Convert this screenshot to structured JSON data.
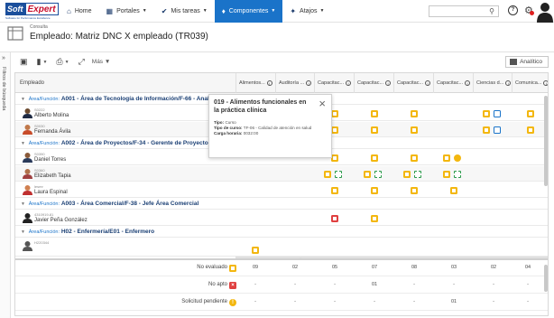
{
  "app": {
    "logo_top": "Soft",
    "logo_bottom": "Expert",
    "logo_sub": "Software for Performance Excellence"
  },
  "nav": {
    "home": "Home",
    "portales": "Portales",
    "mis_tareas": "Mis tareas",
    "componentes": "Componentes",
    "atajos": "Atajos"
  },
  "header": {
    "breadcrumb": "Consulta",
    "title": "Empleado: Matriz DNC X empleado (TR039)"
  },
  "leftbar": {
    "label": "Filtros de búsqueda"
  },
  "toolbar": {
    "more": "Más",
    "analitico": "Analítico"
  },
  "grid": {
    "first_col": "Empleado",
    "columns": [
      "Alimentos...",
      "Auditoría ...",
      "Capacitac...",
      "Capacitac...",
      "Capacitac...",
      "Capacitac...",
      "Ciencias d...",
      "Comunica..."
    ],
    "groups": [
      {
        "prefix": "Área/Función:",
        "name": "A001 - Área de Tecnología de Información/F-66 - Anal"
      },
      {
        "prefix": "Área/Función:",
        "name": "A002 - Área de Proyectos/F-34 - Gerente de Proyectos"
      },
      {
        "prefix": "Área/Función:",
        "name": "A003 - Área Comercial/F-38 - Jefe Área Comercial"
      },
      {
        "prefix": "Área/Función:",
        "name": "H02 - Enfermería/E01 - Enfermero"
      }
    ],
    "employees": [
      {
        "id": "S0222",
        "name": "Alberto Molina"
      },
      {
        "id": "S0030",
        "name": "Fernanda Ávila"
      },
      {
        "id": "S0390",
        "name": "Daniel Torres"
      },
      {
        "id": "S0360",
        "name": "Elizabeth Tapia"
      },
      {
        "id": "lesmr",
        "name": "Laura Espinal"
      },
      {
        "id": "4310919-81",
        "name": "Javier Peña González"
      },
      {
        "id": "H220344",
        "name": ""
      }
    ]
  },
  "tooltip": {
    "title": "019 - Alimentos funcionales en la práctica clínica",
    "line1_label": "Tipo:",
    "line1_value": "Curso",
    "line2_label": "Tipo de curso:",
    "line2_value": "TF-06 - Calidad de atención en salud",
    "line3_label": "Carga horaria:",
    "line3_value": "0032:00"
  },
  "summary": {
    "rows": [
      {
        "label": "No evaluado",
        "values": [
          "09",
          "02",
          "05",
          "07",
          "08",
          "03",
          "02",
          "04"
        ]
      },
      {
        "label": "No apto",
        "values": [
          "-",
          "-",
          "-",
          "01",
          "-",
          "-",
          "-",
          "-"
        ]
      },
      {
        "label": "Solicitud pendiente",
        "values": [
          "-",
          "-",
          "-",
          "-",
          "-",
          "01",
          "-",
          "-"
        ]
      }
    ]
  },
  "colors": {
    "accent": "#1a73c9",
    "pending": "#f3b70f",
    "fail": "#e04040",
    "brand": "#1b4f9c"
  }
}
